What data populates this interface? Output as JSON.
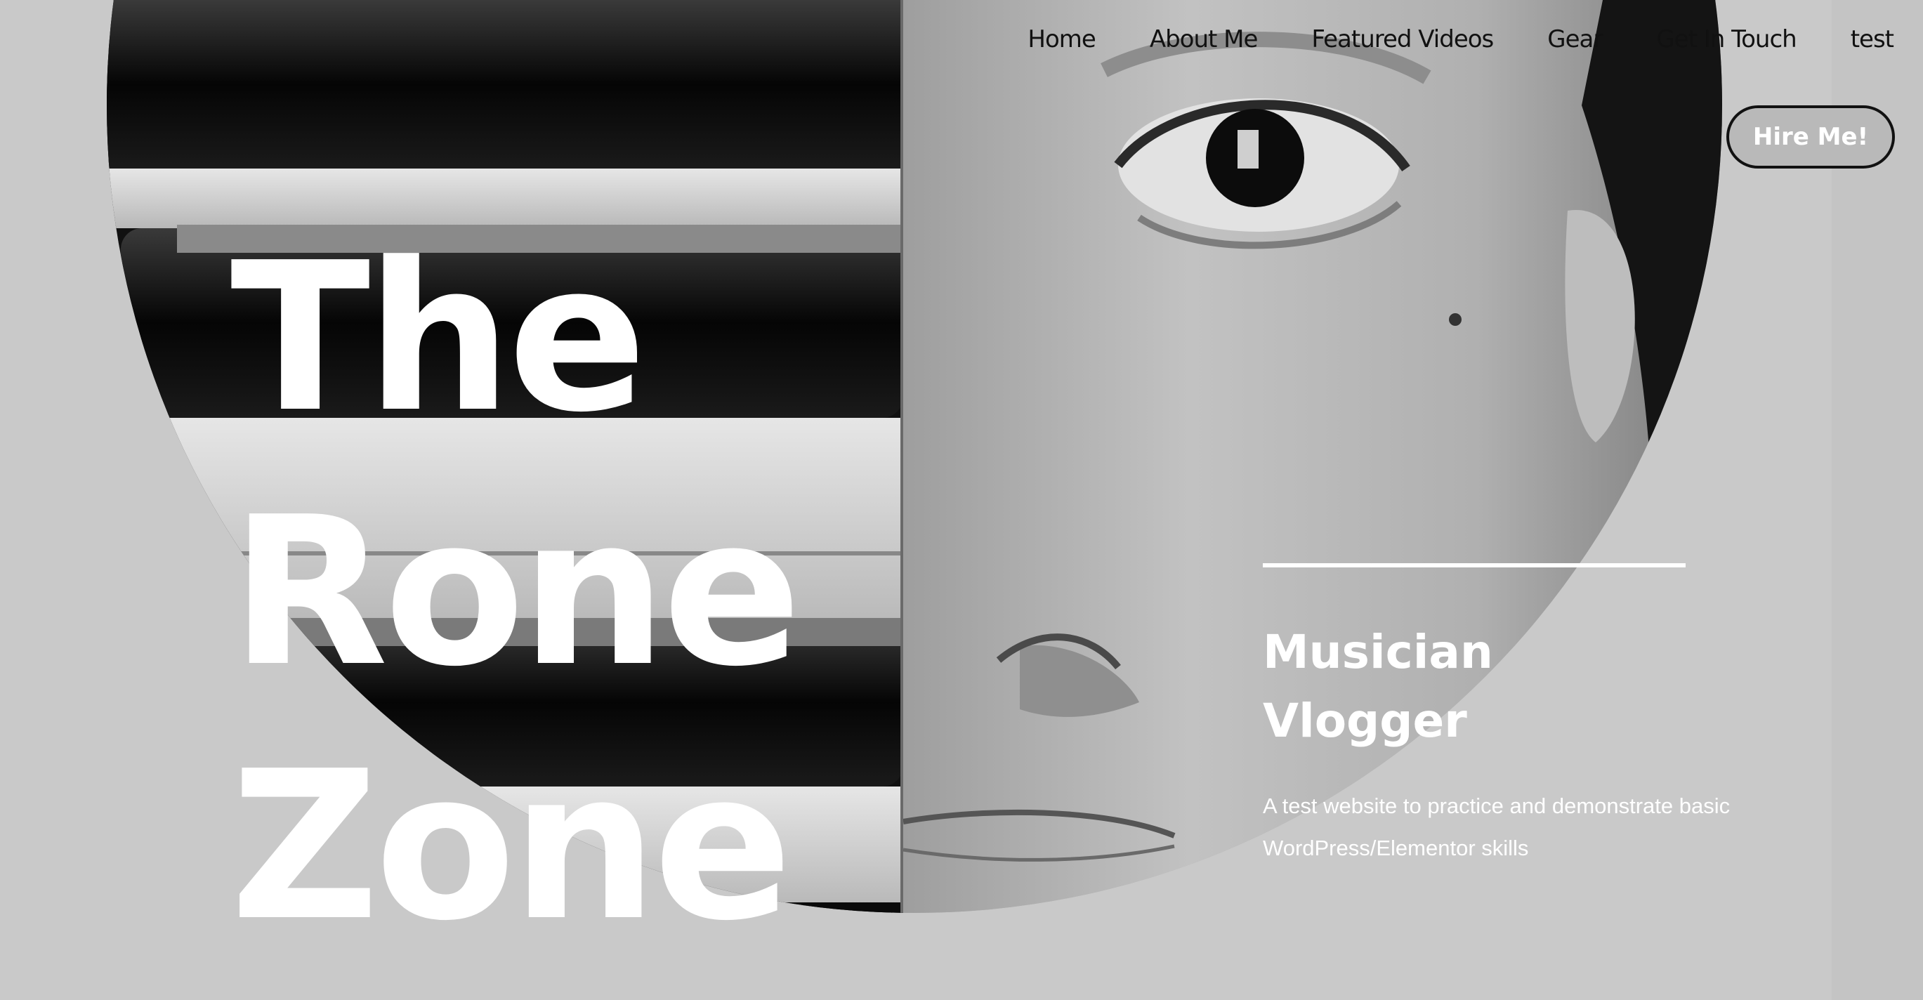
{
  "nav": {
    "items": [
      {
        "label": "Home"
      },
      {
        "label": "About Me"
      },
      {
        "label": "Featured Videos"
      },
      {
        "label": "Gear"
      },
      {
        "label": "Get In Touch"
      },
      {
        "label": "test"
      }
    ],
    "cta_label": "Hire Me!"
  },
  "hero": {
    "title_lines": [
      "The",
      "Rone",
      "Zone"
    ],
    "roles": [
      "Musician",
      "Vlogger"
    ],
    "tagline": "A test website to practice and demonstrate basic WordPress/Elementor skills"
  },
  "colors": {
    "background": "#c9c9c9",
    "text_light": "#ffffff",
    "text_dark": "#111111"
  }
}
